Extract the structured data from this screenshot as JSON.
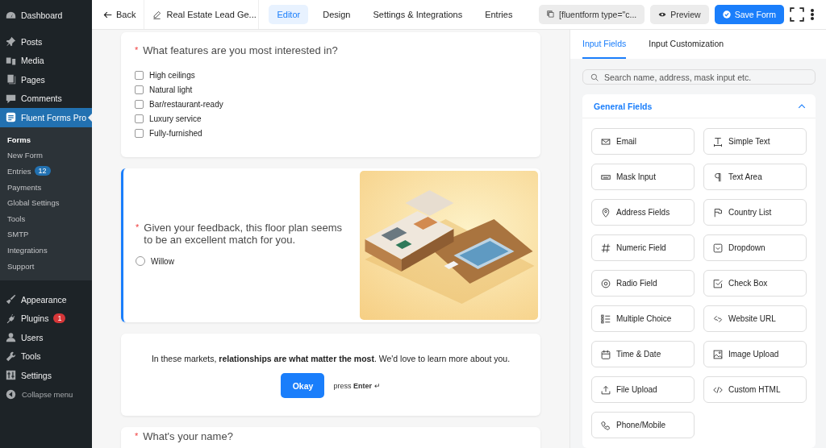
{
  "sidebar": {
    "items": [
      {
        "label": "Dashboard",
        "selected": false
      },
      {
        "label": "Posts",
        "selected": false
      },
      {
        "label": "Media",
        "selected": false
      },
      {
        "label": "Pages",
        "selected": false
      },
      {
        "label": "Comments",
        "selected": false
      },
      {
        "label": "Fluent Forms Pro",
        "selected": true,
        "children": [
          {
            "label": "Forms",
            "selected": true
          },
          {
            "label": "New Form",
            "selected": false
          },
          {
            "label": "Entries",
            "badge": "12",
            "selected": false
          },
          {
            "label": "Payments",
            "selected": false
          },
          {
            "label": "Global Settings",
            "selected": false
          },
          {
            "label": "Tools",
            "selected": false
          },
          {
            "label": "SMTP",
            "selected": false
          },
          {
            "label": "Integrations",
            "selected": false
          },
          {
            "label": "Support",
            "selected": false
          }
        ]
      },
      {
        "label": "Appearance",
        "selected": false
      },
      {
        "label": "Plugins",
        "badge": "1",
        "selected": false
      },
      {
        "label": "Users",
        "selected": false
      },
      {
        "label": "Tools",
        "selected": false
      },
      {
        "label": "Settings",
        "selected": false
      }
    ],
    "collapse": "Collapse menu"
  },
  "toolbar": {
    "back": "Back",
    "form_title": "Real Estate Lead Ge...",
    "tabs": [
      {
        "label": "Editor",
        "selected": true
      },
      {
        "label": "Design",
        "selected": false
      },
      {
        "label": "Settings & Integrations",
        "selected": false
      },
      {
        "label": "Entries",
        "selected": false
      }
    ],
    "shortcode": "[fluentform type=\"c...",
    "preview": "Preview",
    "save": "Save Form"
  },
  "form": {
    "cards": [
      {
        "kind": "checkbox",
        "mark": "*",
        "question": "What features are you most interested in?",
        "options": [
          {
            "label": "High ceilings",
            "checked": false
          },
          {
            "label": "Natural light",
            "checked": false
          },
          {
            "label": "Bar/restaurant-ready",
            "checked": false
          },
          {
            "label": "Luxury service",
            "checked": false
          },
          {
            "label": "Fully-furnished",
            "checked": false
          }
        ]
      },
      {
        "kind": "radio",
        "mark": "*",
        "active": true,
        "question": "Given your feedback, this floor plan seems to be an excellent match for you.",
        "options": [
          {
            "label": "Willow",
            "selected": false
          }
        ],
        "image": {
          "kind": "picture"
        }
      },
      {
        "kind": "statement",
        "text": "In these markets, **relationships are what matter the most**. We'd love to learn more about you.",
        "button": "Okay",
        "hint": "press **Enter** ↵"
      },
      {
        "kind": "text",
        "mark": "*",
        "question": "What's your name?"
      }
    ]
  },
  "panel": {
    "tabs": [
      {
        "label": "Input Fields",
        "selected": true
      },
      {
        "label": "Input Customization",
        "selected": false
      }
    ],
    "search": {
      "placeholder": "Search name, address, mask input etc."
    },
    "group": {
      "title": "General Fields",
      "expanded": true,
      "fields": [
        "Email",
        "Simple Text",
        "Mask Input",
        "Text Area",
        "Address Fields",
        "Country List",
        "Numeric Field",
        "Dropdown",
        "Radio Field",
        "Check Box",
        "Multiple Choice",
        "Website URL",
        "Time & Date",
        "Image Upload",
        "File Upload",
        "Custom HTML",
        "Phone/Mobile"
      ]
    }
  }
}
